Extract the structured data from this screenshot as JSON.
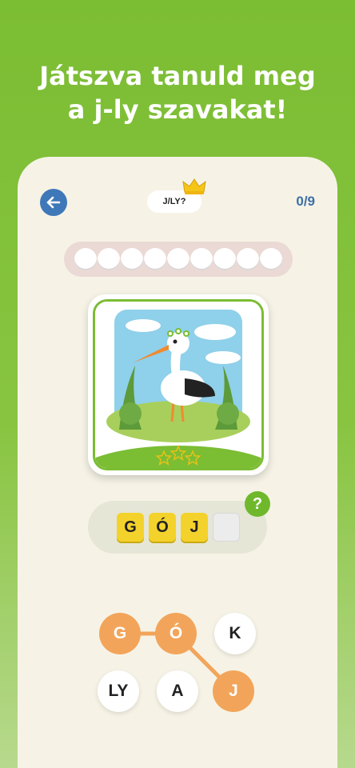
{
  "headline": {
    "line1": "Játszva tanuld meg",
    "line2": "a j-ly szavakat!"
  },
  "topbar": {
    "back_icon": "arrow-left-icon",
    "title": "J/LY?",
    "crown_icon": "crown-icon",
    "counter": "0/9"
  },
  "progress": {
    "total": 9,
    "completed": 0
  },
  "card": {
    "image": "stork-with-flower-crown",
    "stars": 3
  },
  "answer": {
    "letters": [
      "G",
      "Ó",
      "J",
      ""
    ],
    "hint_label": "?"
  },
  "letter_wheel": {
    "tiles": [
      {
        "label": "G",
        "selected": true
      },
      {
        "label": "Ó",
        "selected": true
      },
      {
        "label": "K",
        "selected": false
      },
      {
        "label": "LY",
        "selected": false
      },
      {
        "label": "A",
        "selected": false
      },
      {
        "label": "J",
        "selected": true
      }
    ]
  },
  "colors": {
    "background": "#7bbd33",
    "accent_green": "#6fb82c",
    "blue": "#3f78b8",
    "tile_selected": "#f2a55a",
    "slot_yellow": "#f4d22c"
  }
}
